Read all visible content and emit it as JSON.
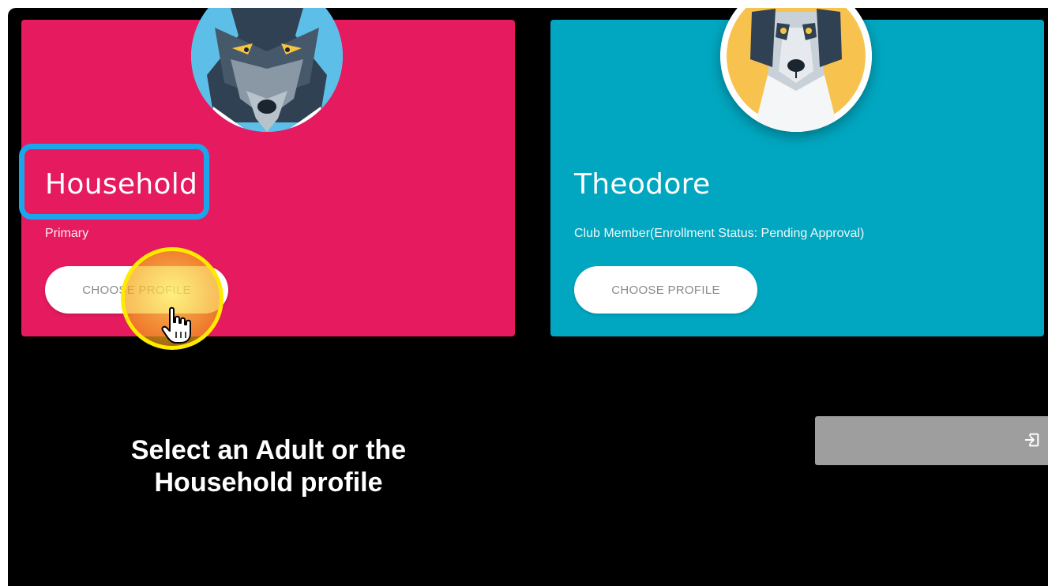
{
  "profiles": [
    {
      "name": "Household",
      "role": "Primary",
      "button_label": "CHOOSE PROFILE",
      "color": "#e51a5f",
      "avatar": "wolf-avatar"
    },
    {
      "name": "Theodore",
      "role": "Club Member(Enrollment Status: Pending Approval)",
      "button_label": "CHOOSE PROFILE",
      "color": "#01a7c0",
      "avatar": "dog-avatar"
    }
  ],
  "caption": "Select an Adult or the Household profile",
  "logout": {
    "icon": "logout-icon"
  },
  "annotation_colors": {
    "highlight_box": "#1ba6ec",
    "click_circle": "#ffea00"
  }
}
